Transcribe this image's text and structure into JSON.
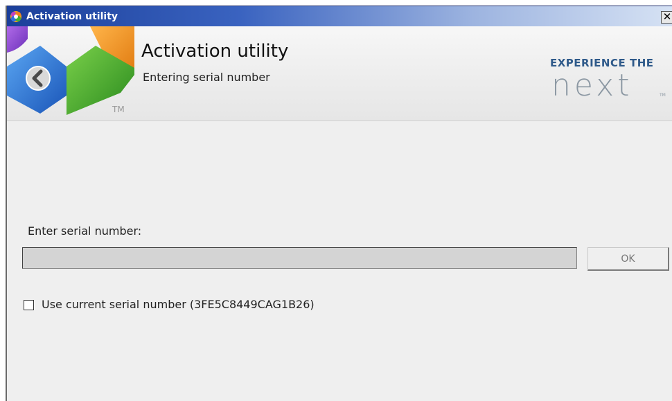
{
  "window": {
    "title": "Activation utility",
    "close_glyph": "✕",
    "app_icon": "app-logo-icon"
  },
  "header": {
    "title": "Activation utility",
    "subtitle": "Entering serial number",
    "tm_mark": "TM",
    "back_icon": "back-arrow-icon",
    "brand": {
      "tagline": "EXPERIENCE THE",
      "name": "next",
      "tm": "TM"
    }
  },
  "form": {
    "serial_label": "Enter serial number:",
    "serial_value": "",
    "ok_label": "OK",
    "use_current_label": "Use current serial number (3FE5C8449CAG1B26)",
    "use_current_checked": false
  },
  "colors": {
    "titlebar_start": "#1b3f9a",
    "brand_blue": "#2f5a8a",
    "brand_gray": "#8c98a3",
    "logo_purple": "#8a4fd0",
    "logo_orange": "#f29a1a",
    "logo_blue": "#2a73d8",
    "logo_green": "#3aa52a"
  }
}
